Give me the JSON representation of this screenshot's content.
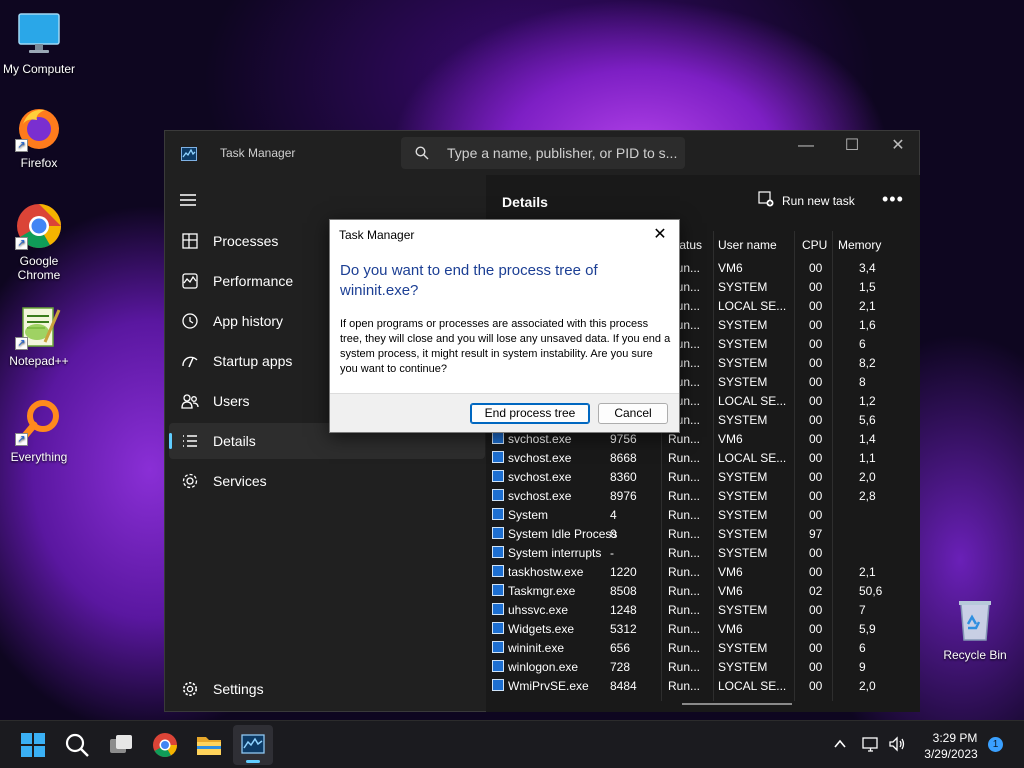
{
  "desktop": {
    "icons": [
      {
        "label": "My Computer"
      },
      {
        "label": "Firefox"
      },
      {
        "label": "Google Chrome"
      },
      {
        "label": "Notepad++"
      },
      {
        "label": "Everything"
      },
      {
        "label": "Recycle Bin"
      }
    ]
  },
  "task_manager": {
    "title": "Task Manager",
    "search_placeholder": "Type a name, publisher, or PID to s...",
    "nav": [
      {
        "label": "Processes",
        "icon": "processes-icon"
      },
      {
        "label": "Performance",
        "icon": "performance-icon"
      },
      {
        "label": "App history",
        "icon": "app-history-icon"
      },
      {
        "label": "Startup apps",
        "icon": "startup-apps-icon"
      },
      {
        "label": "Users",
        "icon": "users-icon"
      },
      {
        "label": "Details",
        "icon": "details-icon",
        "active": true
      }
    ],
    "settings_label": "Settings",
    "page_title": "Details",
    "run_new_task_label": "Run new task",
    "more_label": "•••",
    "columns": {
      "status": "Status",
      "user": "User name",
      "cpu": "CPU",
      "memory": "Memory"
    },
    "hidden_rows": [
      {
        "status": "Run...",
        "user": "VM6",
        "cpu": "00",
        "mem": "3,4"
      },
      {
        "status": "Run...",
        "user": "SYSTEM",
        "cpu": "00",
        "mem": "1,5"
      },
      {
        "status": "Run...",
        "user": "LOCAL SE...",
        "cpu": "00",
        "mem": "2,1"
      },
      {
        "status": "Run...",
        "user": "SYSTEM",
        "cpu": "00",
        "mem": "1,6"
      },
      {
        "status": "Run...",
        "user": "SYSTEM",
        "cpu": "00",
        "mem": "6"
      },
      {
        "status": "Run...",
        "user": "SYSTEM",
        "cpu": "00",
        "mem": "8,2"
      },
      {
        "status": "Run...",
        "user": "SYSTEM",
        "cpu": "00",
        "mem": "8"
      },
      {
        "status": "Run...",
        "user": "LOCAL SE...",
        "cpu": "00",
        "mem": "1,2"
      },
      {
        "status": "Run...",
        "user": "SYSTEM",
        "cpu": "00",
        "mem": "5,6"
      }
    ],
    "rows": [
      {
        "name": "svchost.exe",
        "pid": "9756",
        "status": "Run...",
        "user": "VM6",
        "cpu": "00",
        "mem": "1,4"
      },
      {
        "name": "svchost.exe",
        "pid": "8668",
        "status": "Run...",
        "user": "LOCAL SE...",
        "cpu": "00",
        "mem": "1,1"
      },
      {
        "name": "svchost.exe",
        "pid": "8360",
        "status": "Run...",
        "user": "SYSTEM",
        "cpu": "00",
        "mem": "2,0"
      },
      {
        "name": "svchost.exe",
        "pid": "8976",
        "status": "Run...",
        "user": "SYSTEM",
        "cpu": "00",
        "mem": "2,8"
      },
      {
        "name": "System",
        "pid": "4",
        "status": "Run...",
        "user": "SYSTEM",
        "cpu": "00",
        "mem": ""
      },
      {
        "name": "System Idle Process",
        "pid": "0",
        "status": "Run...",
        "user": "SYSTEM",
        "cpu": "97",
        "mem": ""
      },
      {
        "name": "System interrupts",
        "pid": "-",
        "status": "Run...",
        "user": "SYSTEM",
        "cpu": "00",
        "mem": ""
      },
      {
        "name": "taskhostw.exe",
        "pid": "1220",
        "status": "Run...",
        "user": "VM6",
        "cpu": "00",
        "mem": "2,1"
      },
      {
        "name": "Taskmgr.exe",
        "pid": "8508",
        "status": "Run...",
        "user": "VM6",
        "cpu": "02",
        "mem": "50,6"
      },
      {
        "name": "uhssvc.exe",
        "pid": "1248",
        "status": "Run...",
        "user": "SYSTEM",
        "cpu": "00",
        "mem": "7"
      },
      {
        "name": "Widgets.exe",
        "pid": "5312",
        "status": "Run...",
        "user": "VM6",
        "cpu": "00",
        "mem": "5,9"
      },
      {
        "name": "wininit.exe",
        "pid": "656",
        "status": "Run...",
        "user": "SYSTEM",
        "cpu": "00",
        "mem": "6"
      },
      {
        "name": "winlogon.exe",
        "pid": "728",
        "status": "Run...",
        "user": "SYSTEM",
        "cpu": "00",
        "mem": "9"
      },
      {
        "name": "WmiPrvSE.exe",
        "pid": "8484",
        "status": "Run...",
        "user": "LOCAL SE...",
        "cpu": "00",
        "mem": "2,0"
      }
    ]
  },
  "dialog": {
    "title": "Task Manager",
    "heading": "Do you want to end the process tree of wininit.exe?",
    "body": "If open programs or processes are associated with this process tree, they will close and you will lose any unsaved data. If you end a system process, it might result in system instability. Are you sure you want to continue?",
    "primary_button": "End process tree",
    "cancel_button": "Cancel",
    "close_glyph": "✕"
  },
  "taskbar": {
    "time": "3:29 PM",
    "date": "3/29/2023",
    "notification_count": "1"
  },
  "colors": {
    "accent": "#60cdff",
    "dialog_heading": "#1c3f94",
    "window_bg": "#202020"
  }
}
